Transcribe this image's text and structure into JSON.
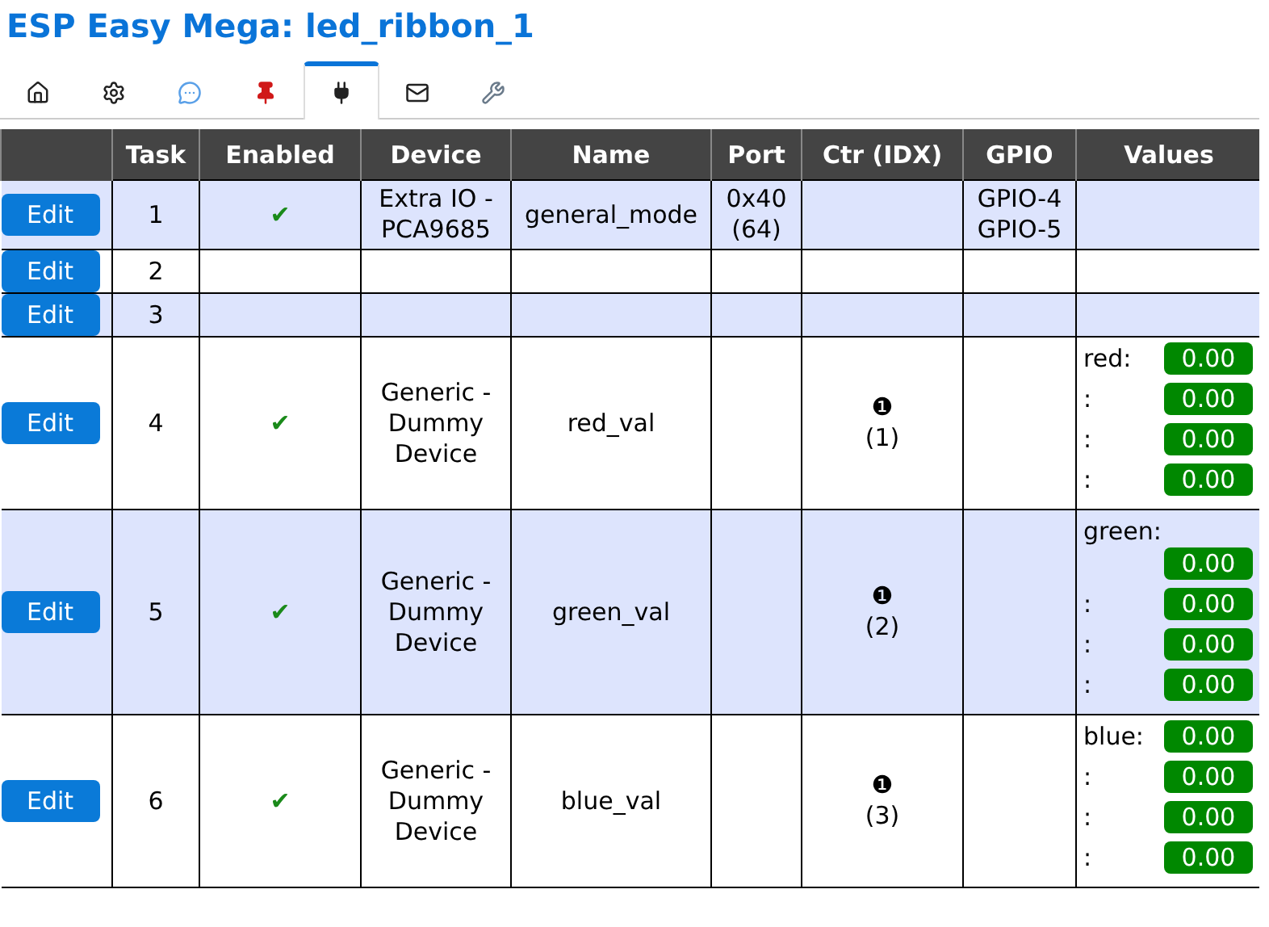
{
  "title": "ESP Easy Mega: led_ribbon_1",
  "tabs": [
    {
      "selected": false
    },
    {
      "selected": false
    },
    {
      "selected": false
    },
    {
      "selected": false
    },
    {
      "selected": true
    },
    {
      "selected": false
    },
    {
      "selected": false
    }
  ],
  "columns": [
    "",
    "Task",
    "Enabled",
    "Device",
    "Name",
    "Port",
    "Ctr (IDX)",
    "GPIO",
    "Values"
  ],
  "rows": [
    {
      "button": "Edit",
      "task": "1",
      "enabled": true,
      "device": [
        "Extra IO -",
        "PCA9685"
      ],
      "name": "general_mode",
      "port": [
        "0x40",
        "(64)"
      ],
      "ctr": [],
      "gpio": [
        "GPIO-4",
        "GPIO-5"
      ],
      "values": []
    },
    {
      "button": "Edit",
      "task": "2",
      "enabled": false,
      "device": [],
      "name": "",
      "port": [],
      "ctr": [],
      "gpio": [],
      "values": []
    },
    {
      "button": "Edit",
      "task": "3",
      "enabled": false,
      "device": [],
      "name": "",
      "port": [],
      "ctr": [],
      "gpio": [],
      "values": []
    },
    {
      "button": "Edit",
      "task": "4",
      "enabled": true,
      "device": [
        "Generic -",
        "Dummy",
        "Device"
      ],
      "name": "red_val",
      "port": [],
      "ctr": [
        "❶",
        "(1)"
      ],
      "gpio": [],
      "values": [
        {
          "label": "red:",
          "value": "0.00"
        },
        {
          "label": ":",
          "value": "0.00"
        },
        {
          "label": ":",
          "value": "0.00"
        },
        {
          "label": ":",
          "value": "0.00"
        }
      ]
    },
    {
      "button": "Edit",
      "task": "5",
      "enabled": true,
      "device": [
        "Generic -",
        "Dummy",
        "Device"
      ],
      "name": "green_val",
      "port": [],
      "ctr": [
        "❶",
        "(2)"
      ],
      "gpio": [],
      "values": [
        {
          "label": "green:",
          "value": "0.00"
        },
        {
          "label": ":",
          "value": "0.00"
        },
        {
          "label": ":",
          "value": "0.00"
        },
        {
          "label": ":",
          "value": "0.00"
        }
      ]
    },
    {
      "button": "Edit",
      "task": "6",
      "enabled": true,
      "device": [
        "Generic -",
        "Dummy",
        "Device"
      ],
      "name": "blue_val",
      "port": [],
      "ctr": [
        "❶",
        "(3)"
      ],
      "gpio": [],
      "values": [
        {
          "label": "blue:",
          "value": "0.00"
        },
        {
          "label": ":",
          "value": "0.00"
        },
        {
          "label": ":",
          "value": "0.00"
        },
        {
          "label": ":",
          "value": "0.00"
        }
      ]
    }
  ],
  "checkmark": "✔"
}
